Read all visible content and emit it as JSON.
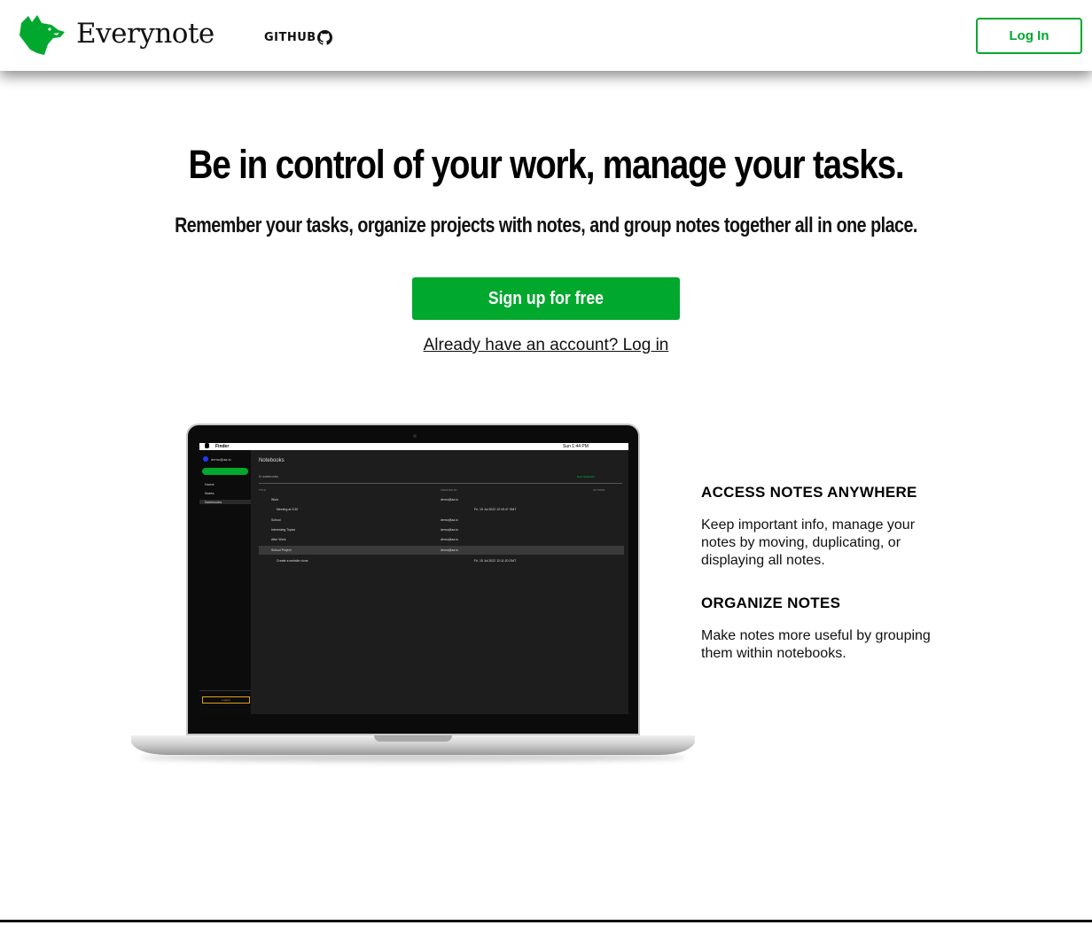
{
  "header": {
    "brand": "Everynote",
    "github_label": "GITHUB",
    "login_label": "Log In",
    "brand_color": "#00a82d"
  },
  "hero": {
    "title": "Be in control of your work, manage your tasks.",
    "subtitle": "Remember your tasks, organize projects with notes, and group notes together all in one place.",
    "signup_label": "Sign up for free",
    "already_link": "Already have an account? Log in"
  },
  "features": [
    {
      "title": "ACCESS NOTES ANYWHERE",
      "body": "Keep important info, manage your notes by moving, duplicating, or displaying all notes."
    },
    {
      "title": "ORGANIZE NOTES",
      "body": "Make notes more useful by grouping them within notebooks."
    }
  ],
  "screenshot": {
    "menubar_app": "Finder",
    "menubar_time": "Sun 1:44 PM",
    "user": "demo@aa.io",
    "new_label": "+ New",
    "nav": [
      "Home",
      "Notes",
      "Notebooks"
    ],
    "logout": "Logout",
    "heading": "Notebooks",
    "subheading": "5 notebooks",
    "new_notebook": "New Notebook",
    "columns": [
      "TITLE",
      "CREATED BY",
      "ACTIONS"
    ],
    "rows": [
      {
        "title": "Work",
        "by": "demo@aa.io",
        "date": ""
      },
      {
        "title": "Meeting at 3:30",
        "by": "",
        "date": "Fri, 15 Jul 2022 12:15:47 GMT"
      },
      {
        "title": "School",
        "by": "demo@aa.io",
        "date": ""
      },
      {
        "title": "Interesting Topics",
        "by": "demo@aa.io",
        "date": ""
      },
      {
        "title": "After Work",
        "by": "demo@aa.io",
        "date": ""
      },
      {
        "title": "School Project",
        "by": "demo@aa.io",
        "date": ""
      },
      {
        "title": "Create a website clone",
        "by": "",
        "date": "Fri, 15 Jul 2022 12:11:20 GMT"
      }
    ]
  }
}
